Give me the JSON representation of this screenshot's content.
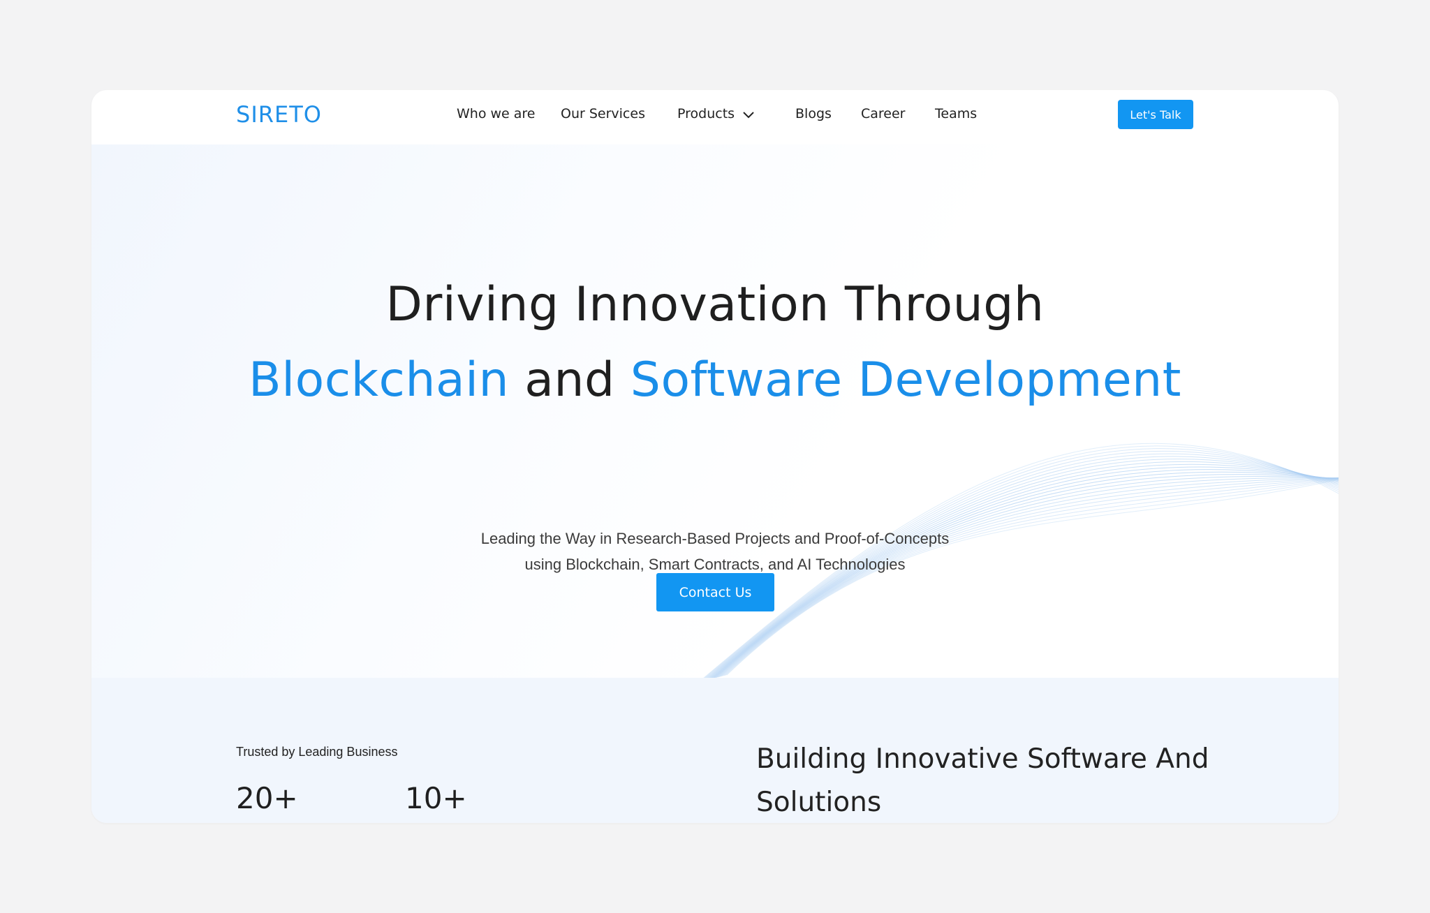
{
  "brand": {
    "logo_text": "SIRETO",
    "accent_color": "#1a8ee9",
    "button_color": "#1296f2"
  },
  "nav": {
    "items": [
      {
        "label": "Who we are"
      },
      {
        "label": "Our Services"
      },
      {
        "label": "Products",
        "icon": "chevron-down-icon"
      },
      {
        "label": "Blogs"
      },
      {
        "label": "Career"
      },
      {
        "label": "Teams"
      }
    ],
    "cta_label": "Let's Talk"
  },
  "hero": {
    "line1": "Driving Innovation Through",
    "line2_a": "Blockchain",
    "line2_b": " and ",
    "line2_c": "Software Development",
    "subtitle_1": "Leading the Way in Research-Based Projects and Proof-of-Concepts",
    "subtitle_2": "using Blockchain, Smart Contracts, and AI Technologies",
    "cta_label": "Contact Us"
  },
  "stats_section": {
    "trusted_label": "Trusted by Leading Business",
    "stats": [
      {
        "value": "20+"
      },
      {
        "value": "10+"
      }
    ],
    "heading": "Building Innovative Software And Solutions"
  }
}
